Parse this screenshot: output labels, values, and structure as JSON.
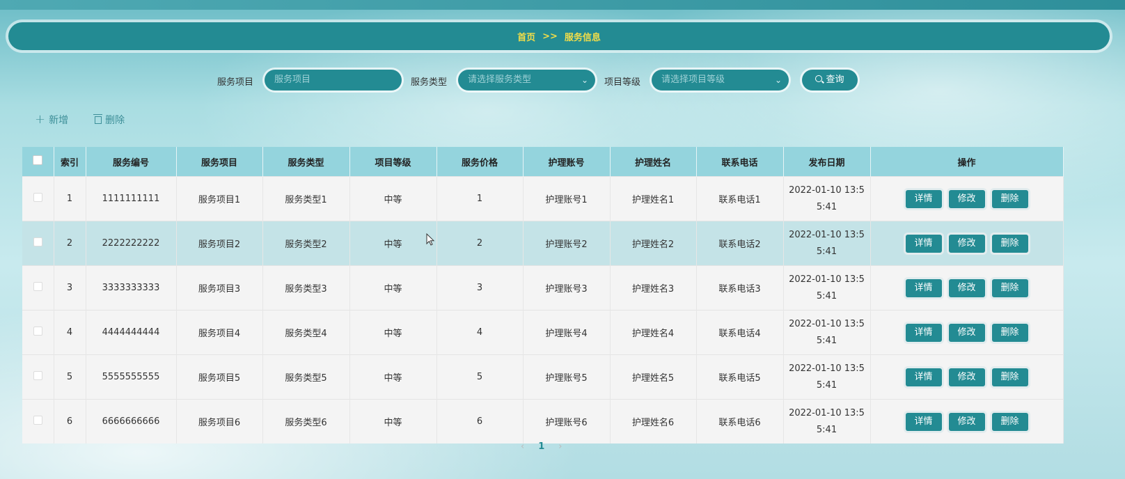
{
  "breadcrumb": {
    "home": "首页",
    "separator": ">>",
    "current": "服务信息"
  },
  "search": {
    "item_label": "服务项目",
    "item_placeholder": "服务项目",
    "type_label": "服务类型",
    "type_placeholder": "请选择服务类型",
    "level_label": "项目等级",
    "level_placeholder": "请选择项目等级",
    "button_label": "查询"
  },
  "toolbar": {
    "add_label": "新增",
    "delete_label": "删除"
  },
  "table": {
    "headers": [
      "索引",
      "服务编号",
      "服务项目",
      "服务类型",
      "项目等级",
      "服务价格",
      "护理账号",
      "护理姓名",
      "联系电话",
      "发布日期",
      "操作"
    ],
    "rows": [
      {
        "index": "1",
        "code": "1111111111",
        "item": "服务项目1",
        "type": "服务类型1",
        "level": "中等",
        "price": "1",
        "account": "护理账号1",
        "name": "护理姓名1",
        "phone": "联系电话1",
        "date_line1": "2022-01-10 13:5",
        "date_line2": "5:41"
      },
      {
        "index": "2",
        "code": "2222222222",
        "item": "服务项目2",
        "type": "服务类型2",
        "level": "中等",
        "price": "2",
        "account": "护理账号2",
        "name": "护理姓名2",
        "phone": "联系电话2",
        "date_line1": "2022-01-10 13:5",
        "date_line2": "5:41"
      },
      {
        "index": "3",
        "code": "3333333333",
        "item": "服务项目3",
        "type": "服务类型3",
        "level": "中等",
        "price": "3",
        "account": "护理账号3",
        "name": "护理姓名3",
        "phone": "联系电话3",
        "date_line1": "2022-01-10 13:5",
        "date_line2": "5:41"
      },
      {
        "index": "4",
        "code": "4444444444",
        "item": "服务项目4",
        "type": "服务类型4",
        "level": "中等",
        "price": "4",
        "account": "护理账号4",
        "name": "护理姓名4",
        "phone": "联系电话4",
        "date_line1": "2022-01-10 13:5",
        "date_line2": "5:41"
      },
      {
        "index": "5",
        "code": "5555555555",
        "item": "服务项目5",
        "type": "服务类型5",
        "level": "中等",
        "price": "5",
        "account": "护理账号5",
        "name": "护理姓名5",
        "phone": "联系电话5",
        "date_line1": "2022-01-10 13:5",
        "date_line2": "5:41"
      },
      {
        "index": "6",
        "code": "6666666666",
        "item": "服务项目6",
        "type": "服务类型6",
        "level": "中等",
        "price": "6",
        "account": "护理账号6",
        "name": "护理姓名6",
        "phone": "联系电话6",
        "date_line1": "2022-01-10 13:5",
        "date_line2": "5:41"
      }
    ],
    "row_buttons": {
      "detail": "详情",
      "edit": "修改",
      "delete": "删除"
    }
  },
  "pagination": {
    "prev": "‹",
    "current_page": "1",
    "next": "›"
  },
  "colors": {
    "primary": "#238b93",
    "header_row": "#94d4dd",
    "breadcrumb_text": "#f1dd49",
    "highlight_row": "#c4e3e7"
  }
}
